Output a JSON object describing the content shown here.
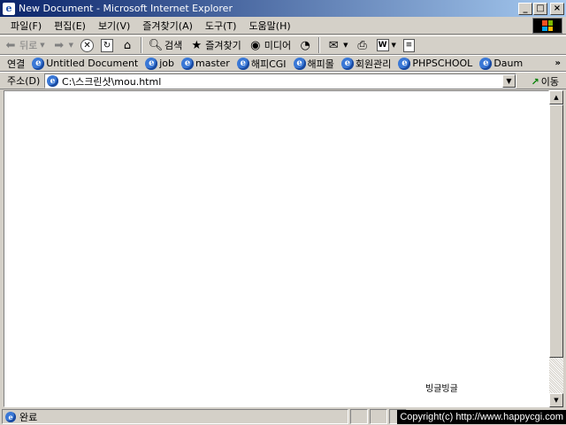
{
  "window": {
    "title": "New Document - Microsoft Internet Explorer"
  },
  "menu": [
    "파일(F)",
    "편집(E)",
    "보기(V)",
    "즐겨찾기(A)",
    "도구(T)",
    "도움말(H)"
  ],
  "toolbar": {
    "back": "뒤로",
    "search": "검색",
    "favorites": "즐겨찾기",
    "media": "미디어"
  },
  "links": {
    "label": "연결",
    "items": [
      "Untitled Document",
      "job",
      "master",
      "해피CGI",
      "해피몰",
      "회원관리",
      "PHPSCHOOL",
      "Daum"
    ],
    "more": "»"
  },
  "address": {
    "label": "주소(D)",
    "value": "C:\\스크린샷\\mou.html",
    "go": "이동"
  },
  "content": {
    "text": "빙글빙글"
  },
  "status": {
    "text": "완료",
    "copyright": "Copyright(c) http://www.happycgi.com"
  }
}
